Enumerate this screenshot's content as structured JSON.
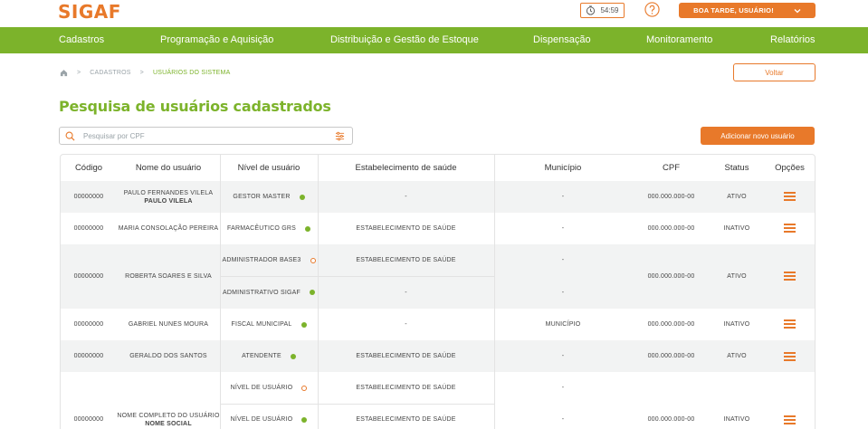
{
  "app": {
    "logo": "SIGAF",
    "timer": "54:59",
    "greeting": "BOA TARDE, USUÁRIO!"
  },
  "nav": [
    "Cadastros",
    "Programação e Aquisição",
    "Distribuição e Gestão de Estoque",
    "Dispensação",
    "Monitoramento",
    "Relatórios"
  ],
  "breadcrumb": {
    "sep": ">",
    "level1": "CADASTROS",
    "current": "USUÁRIOS DO SISTEMA"
  },
  "actions": {
    "back": "Voltar",
    "add": "Adicionar novo usuário"
  },
  "page": {
    "title": "Pesquisa de usuários cadastrados"
  },
  "search": {
    "placeholder": "Pesquisar por CPF",
    "value": ""
  },
  "table": {
    "headers": [
      "Código",
      "Nome do usuário",
      "Nível de usuário",
      "Estabelecimento de saúde",
      "Município",
      "CPF",
      "Status",
      "Opções"
    ],
    "rows": [
      {
        "code": "00000000",
        "name": "PAULO FERNANDES VILELA",
        "social": "PAULO VILELA",
        "cpf": "000.000.000-00",
        "status": "ATIVO",
        "levels": [
          {
            "level": "GESTOR MASTER",
            "dot": "green",
            "estab": "-",
            "municipio": "-"
          }
        ]
      },
      {
        "code": "00000000",
        "name": "MARIA CONSOLAÇÃO PEREIRA",
        "social": "",
        "cpf": "000.000.000-00",
        "status": "INATIVO",
        "levels": [
          {
            "level": "FARMACÊUTICO GRS",
            "dot": "green",
            "estab": "ESTABELECIMENTO DE SAÚDE",
            "municipio": "-"
          }
        ]
      },
      {
        "code": "00000000",
        "name": "ROBERTA SOARES E SILVA",
        "social": "",
        "cpf": "000.000.000-00",
        "status": "ATIVO",
        "levels": [
          {
            "level": "ADMINISTRADOR BASE3",
            "dot": "orange",
            "estab": "ESTABELECIMENTO DE SAÚDE",
            "municipio": "-"
          },
          {
            "level": "ADMINISTRATIVO SIGAF",
            "dot": "green",
            "estab": "-",
            "municipio": "-"
          }
        ]
      },
      {
        "code": "00000000",
        "name": "GABRIEL NUNES MOURA",
        "social": "",
        "cpf": "000.000.000-00",
        "status": "INATIVO",
        "levels": [
          {
            "level": "FISCAL MUNICIPAL",
            "dot": "green",
            "estab": "-",
            "municipio": "MUNICÍPIO"
          }
        ]
      },
      {
        "code": "00000000",
        "name": "GERALDO DOS SANTOS",
        "social": "",
        "cpf": "000.000.000-00",
        "status": "ATIVO",
        "levels": [
          {
            "level": "ATENDENTE",
            "dot": "green",
            "estab": "ESTABELECIMENTO DE SAÚDE",
            "municipio": "-"
          }
        ]
      },
      {
        "code": "00000000",
        "name": "NOME COMPLETO DO USUÁRIO",
        "social": "NOME SOCIAL",
        "cpf": "000.000.000-00",
        "status": "INATIVO",
        "levels": [
          {
            "level": "NÍVEL DE USUÁRIO",
            "dot": "orange",
            "estab": "ESTABELECIMENTO DE SAÚDE",
            "municipio": "-"
          },
          {
            "level": "NÍVEL DE USUÁRIO",
            "dot": "green",
            "estab": "ESTABELECIMENTO DE SAÚDE",
            "municipio": "-"
          }
        ]
      }
    ]
  },
  "colors": {
    "brand_orange": "#e8792a",
    "brand_green": "#7cb32b",
    "row_alt": "#f2f3f3"
  },
  "icons": [
    "clock-icon",
    "help-icon",
    "chevron-down-icon",
    "home-icon",
    "search-icon",
    "filter-icon",
    "menu-icon"
  ]
}
